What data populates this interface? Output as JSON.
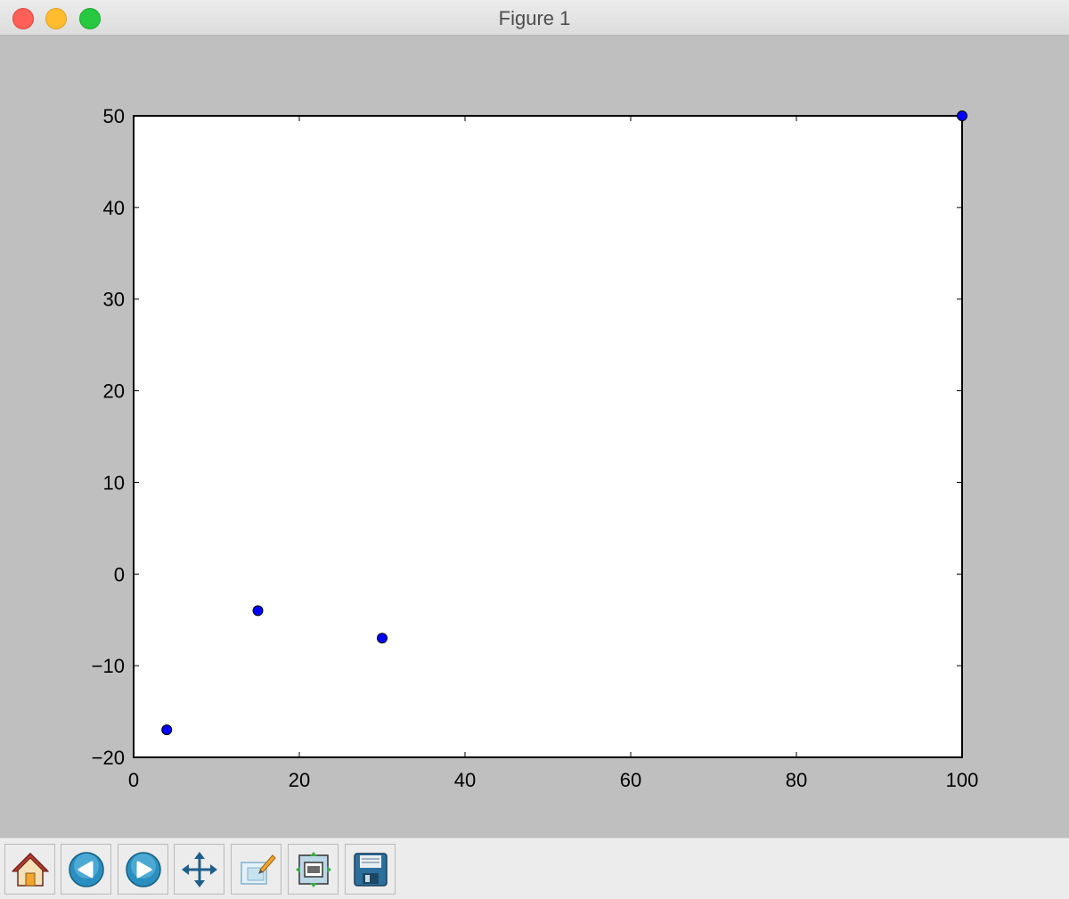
{
  "window": {
    "title": "Figure 1"
  },
  "toolbar": {
    "buttons": [
      {
        "name": "home-button",
        "icon": "home-icon"
      },
      {
        "name": "back-button",
        "icon": "back-arrow-icon"
      },
      {
        "name": "forward-button",
        "icon": "forward-arrow-icon"
      },
      {
        "name": "pan-button",
        "icon": "move-icon"
      },
      {
        "name": "zoom-button",
        "icon": "zoom-rect-icon"
      },
      {
        "name": "subplots-button",
        "icon": "subplots-icon"
      },
      {
        "name": "save-button",
        "icon": "save-icon"
      }
    ]
  },
  "colors": {
    "marker": "#0000ff",
    "axes_bg": "#ffffff",
    "figure_bg": "#bfbfbf"
  },
  "chart_data": {
    "type": "scatter",
    "title": "",
    "xlabel": "",
    "ylabel": "",
    "xlim": [
      0,
      100
    ],
    "ylim": [
      -20,
      50
    ],
    "grid": false,
    "x_ticks": [
      "0",
      "20",
      "40",
      "60",
      "80",
      "100"
    ],
    "y_ticks": [
      "−20",
      "−10",
      "0",
      "10",
      "20",
      "30",
      "40",
      "50"
    ],
    "series": [
      {
        "x": [
          4,
          15,
          30,
          100
        ],
        "y": [
          -17,
          -4,
          -7,
          50
        ]
      }
    ]
  }
}
